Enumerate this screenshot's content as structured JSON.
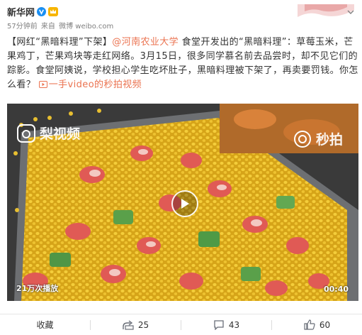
{
  "post": {
    "author": "新华网",
    "time": "57分钟前",
    "source_prefix": "来自",
    "source": "微博 weibo.com",
    "text_tag": "【网红“黑暗料理”下架】",
    "mention": "@河南农业大学",
    "text_main": " 食堂开发出的“黑暗料理”：草莓玉米，芒果鸡丁，芒果鸡块等走红网络。3月15日，很多同学慕名前去品尝时，却不见它们的踪影。食堂阿姨说，学校担心学生吃坏肚子，黑暗料理被下架了，再卖要罚钱。你怎么看？",
    "video_link": "一手video的秒拍视频"
  },
  "video": {
    "watermark_left": "梨视频",
    "watermark_right": "秒拍",
    "play_count": "21万次播放",
    "duration": "00:40"
  },
  "actions": {
    "favorite": "收藏",
    "repost_count": "25",
    "comment_count": "43",
    "like_count": "60"
  },
  "colors": {
    "link": "#eb7350",
    "accent": "#f7b500",
    "verified": "#1a8ff2"
  }
}
